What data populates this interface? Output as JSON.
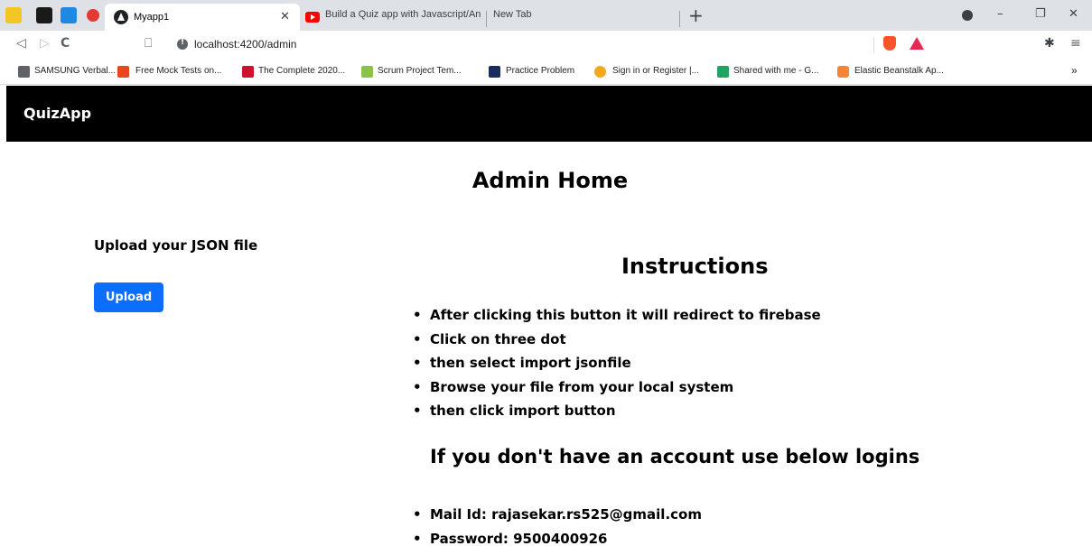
{
  "browser": {
    "tabs": [
      {
        "title": "Myapp1",
        "active": true
      },
      {
        "title": "Build a Quiz app with Javascript/Angu",
        "active": false
      },
      {
        "title": "New Tab",
        "active": false
      }
    ],
    "new_tab_label": "+",
    "window_controls": {
      "minimize": "–",
      "restore": "❐",
      "close": "✕"
    },
    "nav": {
      "back": "◁",
      "forward": "▷",
      "reload": "C",
      "bookmark": "⎕"
    },
    "address": "localhost:4200/admin",
    "extensions_label": "✱",
    "menu_label": "≡",
    "bookmarks": [
      {
        "label": "SAMSUNG Verbal...",
        "icon_color": "#5f6368"
      },
      {
        "label": "Free Mock Tests on...",
        "icon_color": "#e8471e"
      },
      {
        "label": "The Complete 2020...",
        "icon_color": "#d0102c"
      },
      {
        "label": "Scrum Project Tem...",
        "icon_color": "#8bc34a"
      },
      {
        "label": "Practice Problem",
        "icon_color": "#1b2b5b"
      },
      {
        "label": "Sign in or Register |...",
        "icon_color": "#f4a81d"
      },
      {
        "label": "Shared with me - G...",
        "icon_color": "#1fa463"
      },
      {
        "label": "Elastic Beanstalk Ap...",
        "icon_color": "#f58536"
      }
    ],
    "bookmarks_more": "»"
  },
  "app": {
    "brand": "QuizApp",
    "page_title": "Admin Home",
    "upload_heading": "Upload your JSON file",
    "upload_button": "Upload",
    "instructions_title": "Instructions",
    "steps": [
      "After clicking this button it will redirect to firebase",
      "Click on three dot",
      "then select import jsonfile",
      "Browse your file from your local system",
      "then click import button"
    ],
    "account_heading": "If you don't have an account use below logins",
    "logins": [
      "Mail Id: rajasekar.rs525@gmail.com",
      "Password: 9500400926"
    ]
  },
  "colors": {
    "navbar_bg": "#000000",
    "primary_button": "#0d6efd",
    "tabstrip_bg": "#dee1e6"
  }
}
